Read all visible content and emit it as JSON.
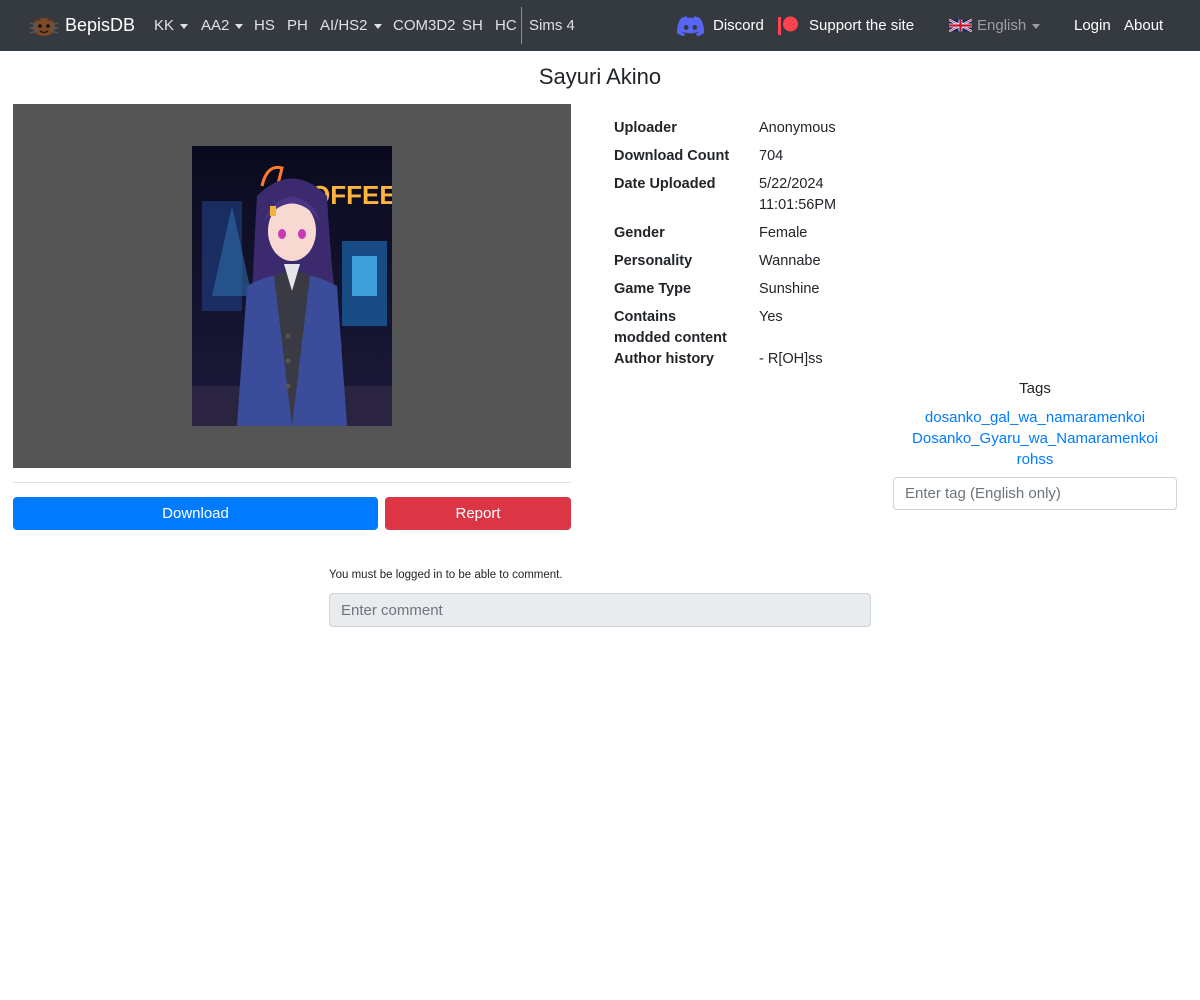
{
  "navbar": {
    "brand": "BepisDB",
    "items": [
      {
        "label": "KK",
        "dropdown": true
      },
      {
        "label": "AA2",
        "dropdown": true
      },
      {
        "label": "HS",
        "dropdown": false
      },
      {
        "label": "PH",
        "dropdown": false
      },
      {
        "label": "AI/HS2",
        "dropdown": true
      },
      {
        "label": "COM3D2",
        "dropdown": false
      },
      {
        "label": "SH",
        "dropdown": false
      },
      {
        "label": "HC",
        "dropdown": false
      },
      {
        "label": "Sims 4",
        "dropdown": false
      }
    ],
    "discord": "Discord",
    "support": "Support the site",
    "language": "English",
    "login": "Login",
    "about": "About"
  },
  "card": {
    "title": "Sayuri Akino",
    "image_sign_text": "OFFEE"
  },
  "actions": {
    "download": "Download",
    "report": "Report"
  },
  "info": {
    "uploader_label": "Uploader",
    "uploader": "Anonymous",
    "download_count_label": "Download Count",
    "download_count": "704",
    "date_label": "Date Uploaded",
    "date": "5/22/2024",
    "time": "11:01:56PM",
    "gender_label": "Gender",
    "gender": "Female",
    "personality_label": "Personality",
    "personality": "Wannabe",
    "game_type_label": "Game Type",
    "game_type": "Sunshine",
    "modded_label_1": "Contains",
    "modded_label_2": "modded content",
    "modded": "Yes",
    "author_history_label": "Author history",
    "author_history": "- R[OH]ss"
  },
  "tags": {
    "heading": "Tags",
    "items": [
      "dosanko_gal_wa_namaramenkoi",
      "Dosanko_Gyaru_wa_Namaramenkoi",
      "rohss"
    ],
    "input_placeholder": "Enter tag (English only)"
  },
  "comments": {
    "login_notice": "You must be logged in to be able to comment.",
    "input_placeholder": "Enter comment"
  },
  "colors": {
    "navbar_bg": "#343a40",
    "primary": "#007bff",
    "danger": "#dc3545",
    "discord": "#5865f2",
    "patreon": "#ff424d"
  }
}
